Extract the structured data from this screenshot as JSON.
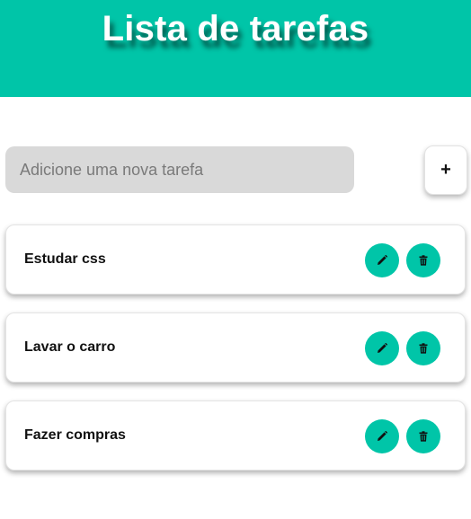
{
  "header": {
    "title": "Lista de tarefas",
    "bg_color": "#00c5a8"
  },
  "new_task": {
    "placeholder": "Adicione uma nova tarefa",
    "value": "",
    "add_label": "+"
  },
  "tasks": [
    {
      "label": "Estudar css"
    },
    {
      "label": "Lavar o carro"
    },
    {
      "label": "Fazer compras"
    }
  ],
  "icons": {
    "edit": "pencil-icon",
    "delete": "trash-icon"
  },
  "colors": {
    "accent": "#00c5a8",
    "input_bg": "#d9d9d9"
  }
}
